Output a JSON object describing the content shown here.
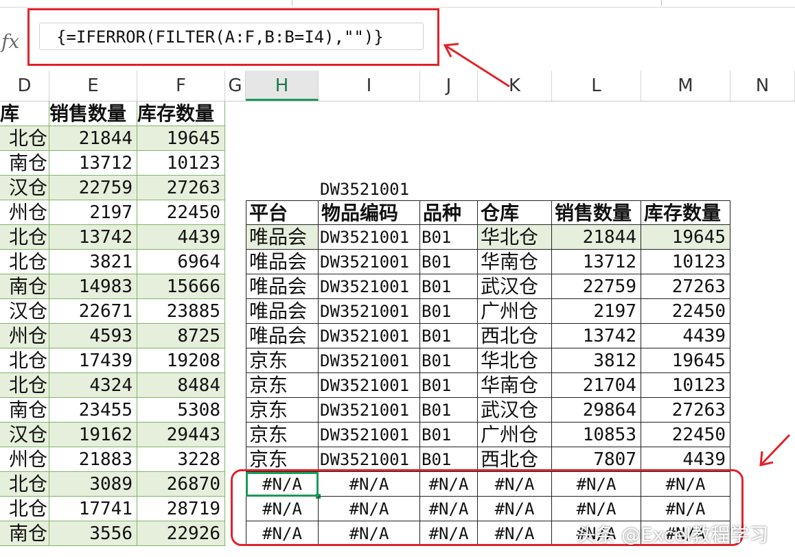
{
  "formula_bar": {
    "fx_label": "fx",
    "formula": "{=IFERROR(FILTER(A:F,B:B=I4),\"\")}"
  },
  "columns": [
    "D",
    "E",
    "F",
    "G",
    "H",
    "I",
    "J",
    "K",
    "L",
    "M",
    "N"
  ],
  "active_column": "H",
  "left_table": {
    "headers": [
      "库",
      "销售数量",
      "库存数量"
    ],
    "rows": [
      [
        "北仓",
        "21844",
        "19645"
      ],
      [
        "南仓",
        "13712",
        "10123"
      ],
      [
        "汉仓",
        "22759",
        "27263"
      ],
      [
        "州仓",
        "2197",
        "22450"
      ],
      [
        "北仓",
        "13742",
        "4439"
      ],
      [
        "北仓",
        "3821",
        "6964"
      ],
      [
        "南仓",
        "14983",
        "15666"
      ],
      [
        "汉仓",
        "22671",
        "23885"
      ],
      [
        "州仓",
        "4593",
        "8725"
      ],
      [
        "北仓",
        "17439",
        "19208"
      ],
      [
        "北仓",
        "4324",
        "8484"
      ],
      [
        "南仓",
        "23455",
        "5308"
      ],
      [
        "汉仓",
        "19162",
        "29443"
      ],
      [
        "州仓",
        "21883",
        "3228"
      ],
      [
        "北仓",
        "3089",
        "26870"
      ],
      [
        "北仓",
        "17741",
        "28719"
      ],
      [
        "南仓",
        "3556",
        "22926"
      ]
    ]
  },
  "lookup_value": "DW3521001",
  "result_table": {
    "headers": [
      "平台",
      "物品编码",
      "品种",
      "仓库",
      "销售数量",
      "库存数量"
    ],
    "rows": [
      [
        "唯品会",
        "DW3521001",
        "B01",
        "华北仓",
        "21844",
        "19645"
      ],
      [
        "唯品会",
        "DW3521001",
        "B01",
        "华南仓",
        "13712",
        "10123"
      ],
      [
        "唯品会",
        "DW3521001",
        "B01",
        "武汉仓",
        "22759",
        "27263"
      ],
      [
        "唯品会",
        "DW3521001",
        "B01",
        "广州仓",
        "2197",
        "22450"
      ],
      [
        "唯品会",
        "DW3521001",
        "B01",
        "西北仓",
        "13742",
        "4439"
      ],
      [
        "京东",
        "DW3521001",
        "B01",
        "华北仓",
        "3812",
        "19645"
      ],
      [
        "京东",
        "DW3521001",
        "B01",
        "华南仓",
        "21704",
        "10123"
      ],
      [
        "京东",
        "DW3521001",
        "B01",
        "武汉仓",
        "29864",
        "27263"
      ],
      [
        "京东",
        "DW3521001",
        "B01",
        "广州仓",
        "10853",
        "22450"
      ],
      [
        "京东",
        "DW3521001",
        "B01",
        "西北仓",
        "7807",
        "4439"
      ]
    ],
    "error_rows": [
      [
        "#N/A",
        "#N/A",
        "#N/A",
        "#N/A",
        "#N/A",
        "#N/A"
      ],
      [
        "#N/A",
        "#N/A",
        "#N/A",
        "#N/A",
        "#N/A",
        "#N/A"
      ],
      [
        "#N/A",
        "#N/A",
        "#N/A",
        "#N/A",
        "#N/A",
        "#N/A"
      ]
    ]
  },
  "colors": {
    "annotation_red": "#e0232a",
    "selection_green": "#1a9a5a",
    "band_green": "#e6efdb"
  },
  "watermark": "头条 @Excel教程学习"
}
